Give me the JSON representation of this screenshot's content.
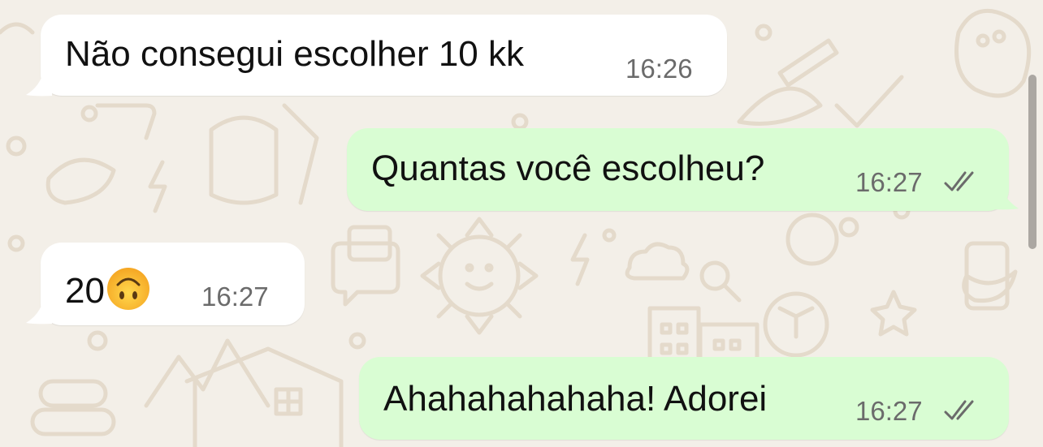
{
  "messages": [
    {
      "direction": "incoming",
      "text": "Não consegui escolher 10 kk",
      "time": "16:26"
    },
    {
      "direction": "outgoing",
      "text": "Quantas você escolheu?",
      "time": "16:27",
      "status": "read",
      "status_icon": "double-check-icon"
    },
    {
      "direction": "incoming",
      "text": "20",
      "emoji": "upside-down-face",
      "time": "16:27"
    },
    {
      "direction": "outgoing",
      "text": "Ahahahahahaha! Adorei",
      "time": "16:27",
      "status": "read",
      "status_icon": "double-check-icon"
    }
  ],
  "colors": {
    "wallpaper": "#f3efe8",
    "doodle": "#e6ddd0",
    "incoming_bubble": "#ffffff",
    "outgoing_bubble": "#d9fdd3",
    "timestamp": "#6b6b6b",
    "checkmark": "#6b6b6b"
  }
}
